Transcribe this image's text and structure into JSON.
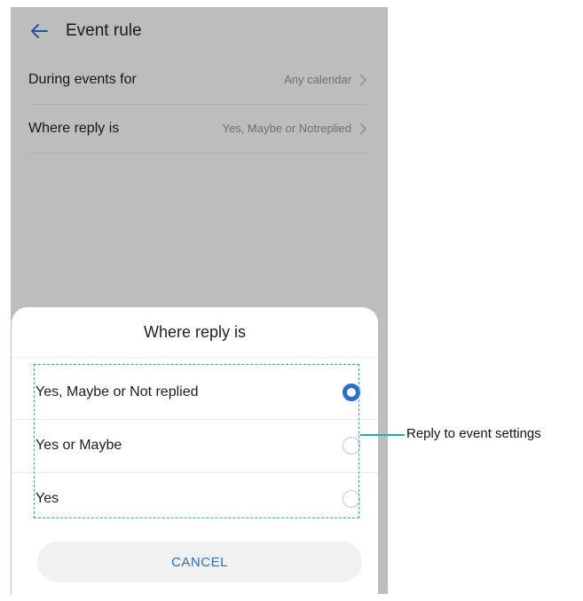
{
  "appbar": {
    "title": "Event rule",
    "back_icon": "arrow-left-icon"
  },
  "settings": [
    {
      "label": "During events for",
      "value": "Any calendar"
    },
    {
      "label": "Where reply is",
      "value": "Yes, Maybe or Notreplied"
    }
  ],
  "dialog": {
    "title": "Where reply is",
    "options": [
      {
        "label": "Yes, Maybe or Not replied",
        "selected": true
      },
      {
        "label": "Yes or Maybe",
        "selected": false
      },
      {
        "label": "Yes",
        "selected": false
      }
    ],
    "cancel_label": "CANCEL"
  },
  "annotation": {
    "label": "Reply to event settings",
    "color": "#29a8b8"
  },
  "colors": {
    "accent": "#2c6ecb"
  }
}
